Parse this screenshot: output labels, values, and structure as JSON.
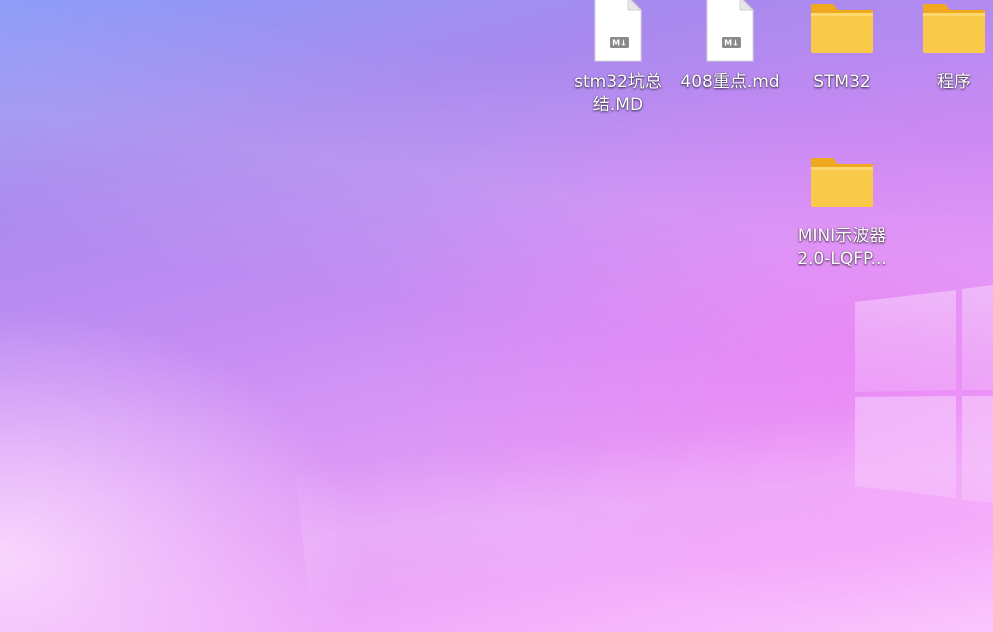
{
  "desktop": {
    "wallpaper": "windows-11-bloom-pink-purple",
    "colors": {
      "accent_top_left": "#8b9cf7",
      "accent_bottom": "#fbc6fd",
      "folder_yellow": "#f9c94a"
    },
    "icons": [
      {
        "label": "stm32坑总结.MD",
        "icon": "markdown-file-icon"
      },
      {
        "label": "408重点.md",
        "icon": "markdown-file-icon"
      },
      {
        "label": "STM32",
        "icon": "folder-icon"
      },
      {
        "label": "程序",
        "icon": "folder-icon"
      },
      {
        "label": "MINI示波器2.0-LQFP...",
        "icon": "folder-icon"
      }
    ]
  }
}
